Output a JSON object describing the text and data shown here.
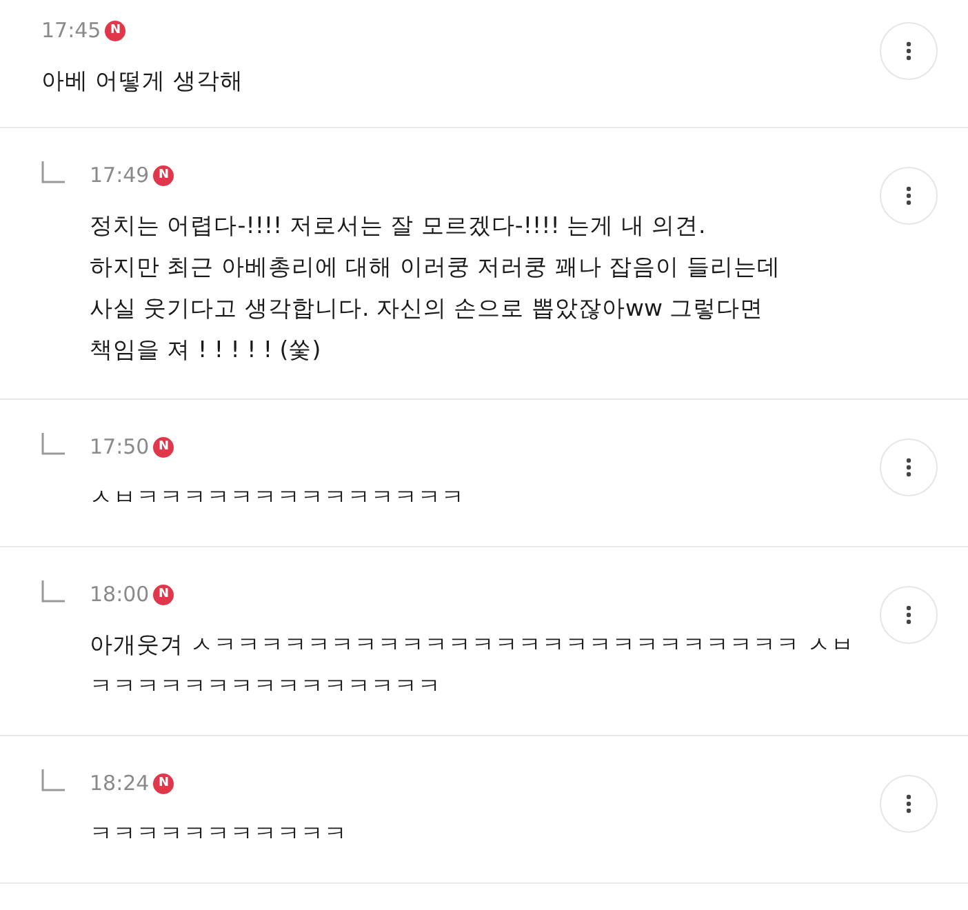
{
  "comments": [
    {
      "is_reply": false,
      "time": "17:45",
      "badge": "N",
      "lines": [
        "아베 어떻게 생각해"
      ]
    },
    {
      "is_reply": true,
      "time": "17:49",
      "badge": "N",
      "lines": [
        "정치는 어렵다-!!!! 저로서는 잘 모르겠다-!!!! 는게 내 의견.",
        "하지만 최근 아베총리에 대해 이러쿵 저러쿵 꽤나 잡음이 들리는데",
        "사실 웃기다고 생각합니다. 자신의 손으로 뽑았잖아ww 그렇다면",
        "책임을 져 ! ! ! ! ! (쑻)"
      ]
    },
    {
      "is_reply": true,
      "time": "17:50",
      "badge": "N",
      "lines": [
        "ㅅㅂㅋㅋㅋㅋㅋㅋㅋㅋㅋㅋㅋㅋㅋㅋ"
      ]
    },
    {
      "is_reply": true,
      "time": "18:00",
      "badge": "N",
      "lines": [
        "아개웃겨 ㅅㅋㅋㅋㅋㅋㅋㅋㅋㅋㅋㅋㅋㅋㅋㅋㅋㅋㅋㅋㅋㅋㅋㅋㅋㅋ ㅅㅂ",
        "ㅋㅋㅋㅋㅋㅋㅋㅋㅋㅋㅋㅋㅋㅋㅋ"
      ]
    },
    {
      "is_reply": true,
      "time": "18:24",
      "badge": "N",
      "lines": [
        "ㅋㅋㅋㅋㅋㅋㅋㅋㅋㅋㅋ"
      ]
    }
  ]
}
